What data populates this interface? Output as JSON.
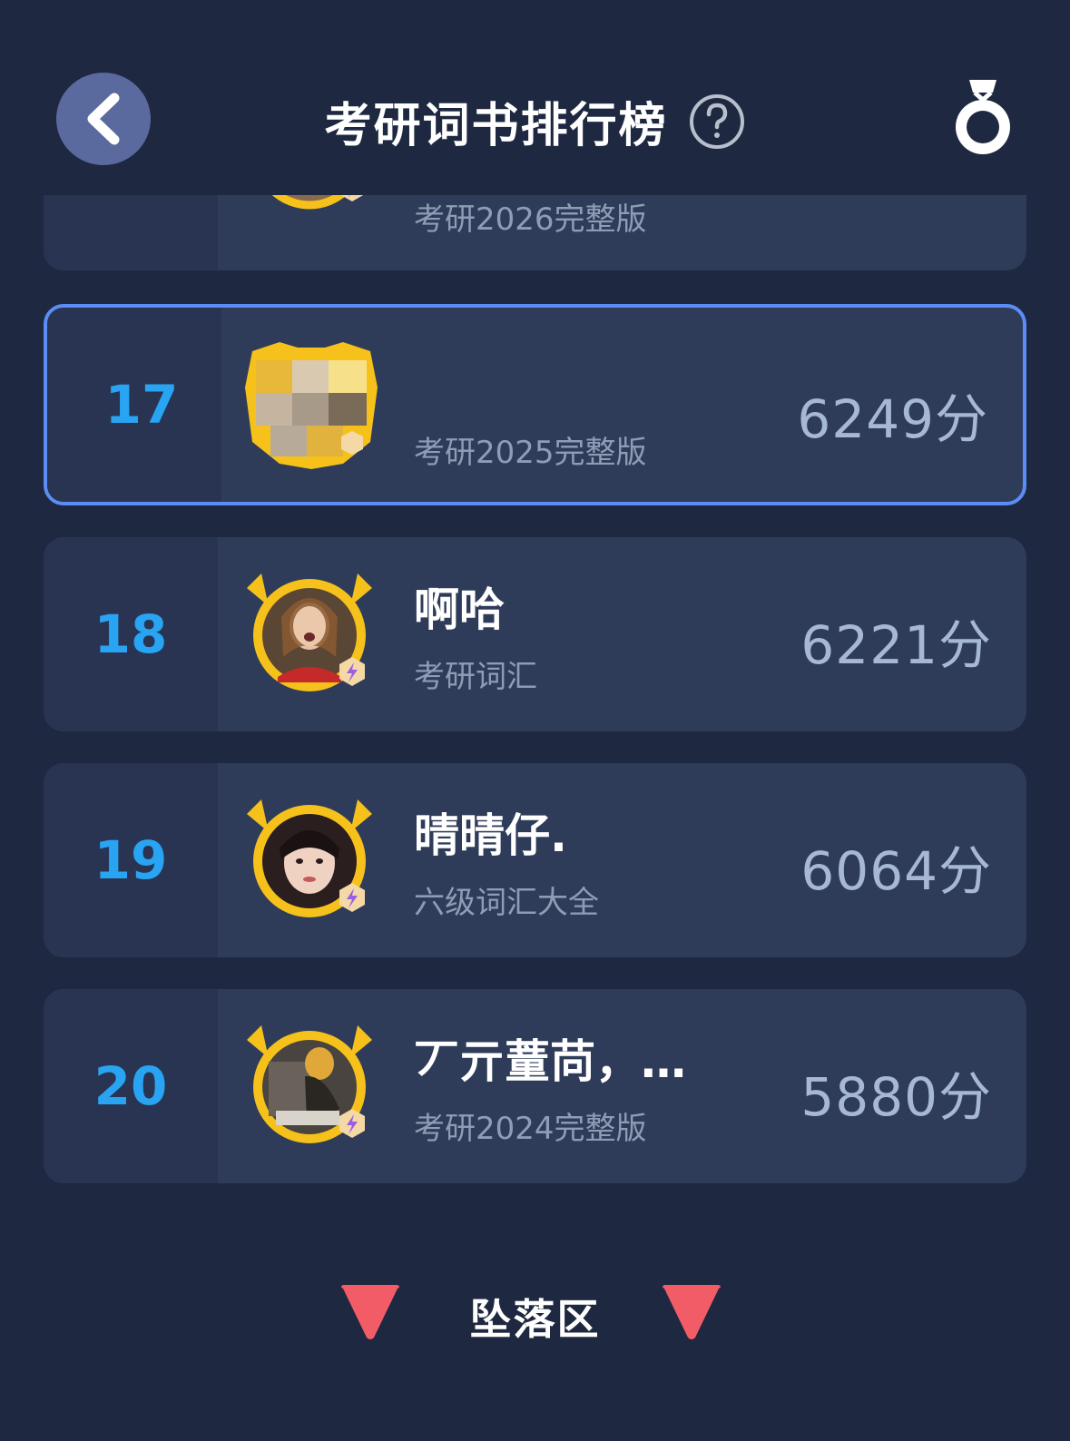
{
  "header": {
    "title": "考研词书排行榜",
    "back_icon": "chevron-left-icon",
    "help_icon": "question-circle-icon",
    "medal_icon": "medal-icon"
  },
  "rows": [
    {
      "rank": "",
      "name": "",
      "book": "考研2026完整版",
      "score": ""
    },
    {
      "rank": "17",
      "name": "",
      "book": "考研2025完整版",
      "score": "6249分",
      "highlighted": true
    },
    {
      "rank": "18",
      "name": "啊哈",
      "book": "考研词汇",
      "score": "6221分"
    },
    {
      "rank": "19",
      "name": "晴晴仔.",
      "book": "六级词汇大全",
      "score": "6064分"
    },
    {
      "rank": "20",
      "name": "丆亓蕫苘，…",
      "book": "考研2024完整版",
      "score": "5880分"
    }
  ],
  "falling_zone": {
    "label": "坠落区",
    "icon": "down-triangle-icon"
  },
  "colors": {
    "background": "#1e2840",
    "card": "#2e3c5a",
    "rank": "#28a4f2",
    "highlight_border": "#5b8df5",
    "avatar_frame": "#f5c11a",
    "falling_triangle": "#f25c67"
  }
}
